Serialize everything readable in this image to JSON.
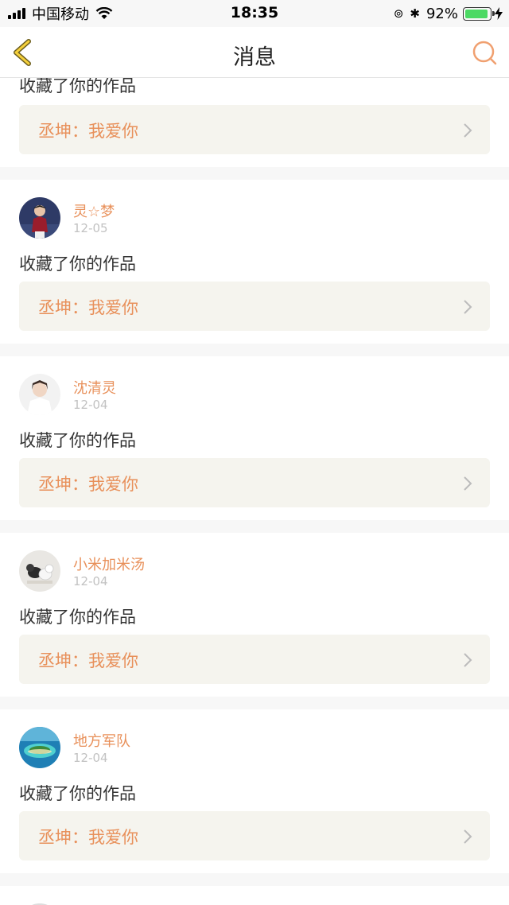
{
  "status_bar": {
    "carrier": "中国移动",
    "time": "18:35",
    "battery_percent": "92%",
    "battery_level": 0.92
  },
  "nav": {
    "title": "消息"
  },
  "colors": {
    "accent": "#e8905a",
    "work_box_bg": "#f5f4ee",
    "separator": "#f7f7f7"
  },
  "top_partial": {
    "action": "收藏了你的作品",
    "work": "丞坤：我爱你"
  },
  "messages": [
    {
      "username": "灵☆梦",
      "date": "12-05",
      "action": "收藏了你的作品",
      "work": "丞坤：我爱你",
      "avatar": "avatar-person-red"
    },
    {
      "username": "沈清灵",
      "date": "12-04",
      "action": "收藏了你的作品",
      "work": "丞坤：我爱你",
      "avatar": "avatar-person-white"
    },
    {
      "username": "小米加米汤",
      "date": "12-04",
      "action": "收藏了你的作品",
      "work": "丞坤：我爱你",
      "avatar": "avatar-dogs"
    },
    {
      "username": "地方军队",
      "date": "12-04",
      "action": "收藏了你的作品",
      "work": "丞坤：我爱你",
      "avatar": "avatar-island"
    }
  ]
}
